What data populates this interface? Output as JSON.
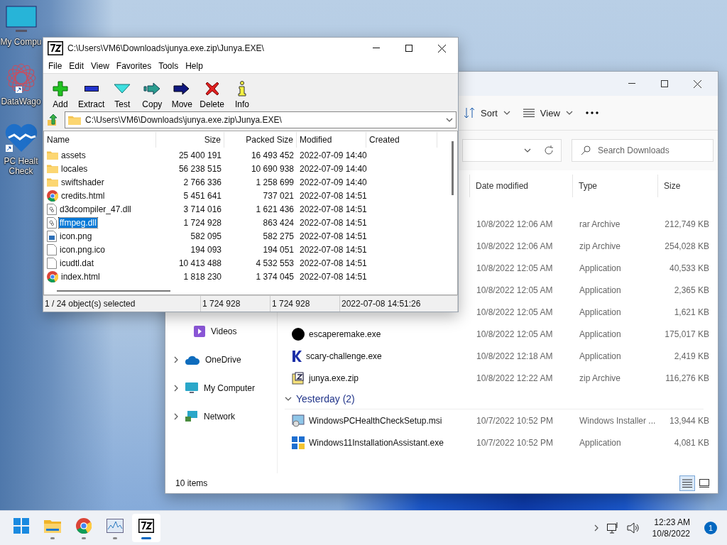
{
  "desktop_icons": [
    {
      "kind": "monitor",
      "lines": [
        "My Compu"
      ]
    },
    {
      "kind": "datawagon",
      "lines": [
        "DataWago"
      ]
    },
    {
      "kind": "health",
      "lines": [
        "PC Healt",
        "Check"
      ]
    }
  ],
  "explorer": {
    "toolbar": [
      {
        "kind": "sort",
        "label": "Sort"
      },
      {
        "kind": "view",
        "label": "View"
      },
      {
        "kind": "more"
      }
    ],
    "search": {
      "placeholder": "Search Downloads"
    },
    "columns": [
      "Date modified",
      "Type",
      "Size"
    ],
    "sidebar": [
      {
        "kind": "videos",
        "label": "Videos"
      },
      {
        "kind": "onedrive",
        "label": "OneDrive",
        "expanded": false
      },
      {
        "kind": "computer",
        "label": "My Computer",
        "expanded": false
      },
      {
        "kind": "network",
        "label": "Network",
        "expanded": false
      }
    ],
    "groups": [
      {
        "rows": [
          {
            "date": "10/8/2022 12:06 AM",
            "type": "rar Archive",
            "size": "212,749 KB"
          },
          {
            "date": "10/8/2022 12:06 AM",
            "type": "zip Archive",
            "size": "254,028 KB"
          },
          {
            "date": "10/8/2022 12:05 AM",
            "type": "Application",
            "size": "40,533 KB"
          },
          {
            "date": "10/8/2022 12:05 AM",
            "type": "Application",
            "size": "2,365 KB"
          },
          {
            "date": "10/8/2022 12:05 AM",
            "type": "Application",
            "size": "1,621 KB"
          },
          {
            "kind": "blackdot",
            "name": "escaperemake.exe",
            "date": "10/8/2022 12:05 AM",
            "type": "Application",
            "size": "175,017 KB"
          },
          {
            "kind": "k",
            "name": "scary-challenge.exe",
            "date": "10/8/2022 12:18 AM",
            "type": "Application",
            "size": "2,419 KB"
          },
          {
            "kind": "zip",
            "name": "junya.exe.zip",
            "date": "10/8/2022 12:22 AM",
            "type": "zip Archive",
            "size": "116,276 KB"
          }
        ]
      },
      {
        "title": "Yesterday (2)",
        "expanded": true,
        "rows": [
          {
            "kind": "msi",
            "name": "WindowsPCHealthCheckSetup.msi",
            "date": "10/7/2022 10:52 PM",
            "type": "Windows Installer ...",
            "size": "13,944 KB"
          },
          {
            "kind": "win",
            "name": "Windows11InstallationAssistant.exe",
            "date": "10/7/2022 10:52 PM",
            "type": "Application",
            "size": "4,081 KB"
          }
        ]
      }
    ],
    "status": "10 items",
    "view_buttons": [
      {
        "kind": "details",
        "selected": true
      },
      {
        "kind": "tiles",
        "selected": false
      }
    ]
  },
  "sevenzip": {
    "title": "C:\\Users\\VM6\\Downloads\\junya.exe.zip\\Junya.EXE\\",
    "menu": [
      "File",
      "Edit",
      "View",
      "Favorites",
      "Tools",
      "Help"
    ],
    "toolbar": [
      {
        "kind": "add",
        "label": "Add"
      },
      {
        "kind": "extract",
        "label": "Extract"
      },
      {
        "kind": "test",
        "label": "Test"
      },
      {
        "kind": "copy",
        "label": "Copy"
      },
      {
        "kind": "move",
        "label": "Move"
      },
      {
        "kind": "delete",
        "label": "Delete"
      },
      {
        "kind": "info",
        "label": "Info"
      }
    ],
    "address": "C:\\Users\\VM6\\Downloads\\junya.exe.zip\\Junya.EXE\\",
    "columns": [
      "Name",
      "Size",
      "Packed Size",
      "Modified",
      "Created"
    ],
    "rows": [
      {
        "kind": "folder",
        "name": "assets",
        "size": "25 400 191",
        "packed": "16 493 452",
        "modified": "2022-07-09 14:40",
        "selected": false
      },
      {
        "kind": "folder",
        "name": "locales",
        "size": "56 238 515",
        "packed": "10 690 938",
        "modified": "2022-07-09 14:40",
        "selected": false
      },
      {
        "kind": "folder",
        "name": "swiftshader",
        "size": "2 766 336",
        "packed": "1 258 699",
        "modified": "2022-07-09 14:40",
        "selected": false
      },
      {
        "kind": "chrome",
        "name": "credits.html",
        "size": "5 451 641",
        "packed": "737 021",
        "modified": "2022-07-08 14:51",
        "selected": false
      },
      {
        "kind": "dll",
        "name": "d3dcompiler_47.dll",
        "size": "3 714 016",
        "packed": "1 621 436",
        "modified": "2022-07-08 14:51",
        "selected": false
      },
      {
        "kind": "dll",
        "name": "ffmpeg.dll",
        "size": "1 724 928",
        "packed": "863 424",
        "modified": "2022-07-08 14:51",
        "selected": true
      },
      {
        "kind": "image",
        "name": "icon.png",
        "size": "582 095",
        "packed": "582 275",
        "modified": "2022-07-08 14:51",
        "selected": false
      },
      {
        "kind": "file",
        "name": "icon.png.ico",
        "size": "194 093",
        "packed": "194 051",
        "modified": "2022-07-08 14:51",
        "selected": false
      },
      {
        "kind": "file",
        "name": "icudtl.dat",
        "size": "10 413 488",
        "packed": "4 532 553",
        "modified": "2022-07-08 14:51",
        "selected": false
      },
      {
        "kind": "chrome",
        "name": "index.html",
        "size": "1 818 230",
        "packed": "1 374 045",
        "modified": "2022-07-08 14:51",
        "selected": false
      }
    ],
    "status": [
      "1 / 24 object(s) selected",
      "1 724 928",
      "1 724 928",
      "2022-07-08 14:51:26"
    ]
  },
  "taskbar": {
    "apps": [
      {
        "kind": "start",
        "running": false,
        "active": false
      },
      {
        "kind": "folder",
        "running": true,
        "active": false
      },
      {
        "kind": "chrome",
        "running": true,
        "active": false
      },
      {
        "kind": "monitor",
        "running": true,
        "active": false
      },
      {
        "kind": "sevenzip",
        "running": true,
        "active": true
      }
    ],
    "time": "12:23 AM",
    "date": "10/8/2022",
    "notifications": "1"
  }
}
